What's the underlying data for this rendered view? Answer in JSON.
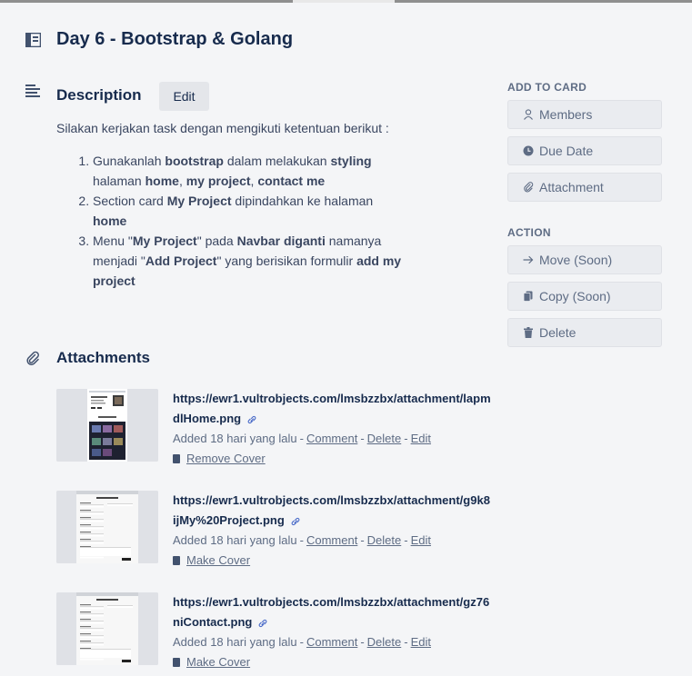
{
  "card": {
    "title": "Day 6 - Bootstrap & Golang"
  },
  "description": {
    "heading": "Description",
    "edit_label": "Edit",
    "intro": "Silakan kerjakan task dengan mengikuti ketentuan berikut :",
    "items": [
      [
        {
          "t": "Gunakanlah ",
          "b": false
        },
        {
          "t": "bootstrap",
          "b": true
        },
        {
          "t": " dalam melakukan ",
          "b": false
        },
        {
          "t": "styling",
          "b": true
        },
        {
          "t": " halaman ",
          "b": false
        },
        {
          "t": "home",
          "b": true
        },
        {
          "t": ", ",
          "b": false
        },
        {
          "t": "my project",
          "b": true
        },
        {
          "t": ", ",
          "b": false
        },
        {
          "t": "contact me",
          "b": true
        }
      ],
      [
        {
          "t": "Section card ",
          "b": false
        },
        {
          "t": "My Project",
          "b": true
        },
        {
          "t": " dipindahkan ke halaman ",
          "b": false
        },
        {
          "t": "home",
          "b": true
        }
      ],
      [
        {
          "t": "Menu \"",
          "b": false
        },
        {
          "t": "My Project",
          "b": true
        },
        {
          "t": "\" pada ",
          "b": false
        },
        {
          "t": "Navbar diganti",
          "b": true
        },
        {
          "t": " namanya menjadi \"",
          "b": false
        },
        {
          "t": "Add Project",
          "b": true
        },
        {
          "t": "\" yang berisikan formulir ",
          "b": false
        },
        {
          "t": "add my project",
          "b": true
        }
      ]
    ]
  },
  "attachments": {
    "heading": "Attachments",
    "items": [
      {
        "url": "https://ewr1.vultrobjects.com/lmsbzzbx/attachment/lapmdlHome.png",
        "added": "Added 18 hari yang lalu",
        "comment": "Comment",
        "delete": "Delete",
        "edit": "Edit",
        "cover": "Remove Cover",
        "thumb": "home"
      },
      {
        "url": "https://ewr1.vultrobjects.com/lmsbzzbx/attachment/g9k8ijMy%20Project.png",
        "added": "Added 18 hari yang lalu",
        "comment": "Comment",
        "delete": "Delete",
        "edit": "Edit",
        "cover": "Make Cover",
        "thumb": "project"
      },
      {
        "url": "https://ewr1.vultrobjects.com/lmsbzzbx/attachment/gz76niContact.png",
        "added": "Added 18 hari yang lalu",
        "comment": "Comment",
        "delete": "Delete",
        "edit": "Edit",
        "cover": "Make Cover",
        "thumb": "contact"
      }
    ]
  },
  "sidebar": {
    "add_heading": "ADD TO CARD",
    "add_items": [
      {
        "label": "Members",
        "icon": "person-icon"
      },
      {
        "label": "Due Date",
        "icon": "clock-icon"
      },
      {
        "label": "Attachment",
        "icon": "paperclip-icon"
      }
    ],
    "action_heading": "ACTION",
    "action_items": [
      {
        "label": "Move (Soon)",
        "icon": "arrow-right-icon"
      },
      {
        "label": "Copy (Soon)",
        "icon": "copy-icon"
      },
      {
        "label": "Delete",
        "icon": "trash-icon"
      }
    ]
  },
  "colors": {
    "background": "#f4f5f7",
    "text": "#172b4d",
    "muted": "#5e6c84",
    "button": "#eaecf0"
  }
}
